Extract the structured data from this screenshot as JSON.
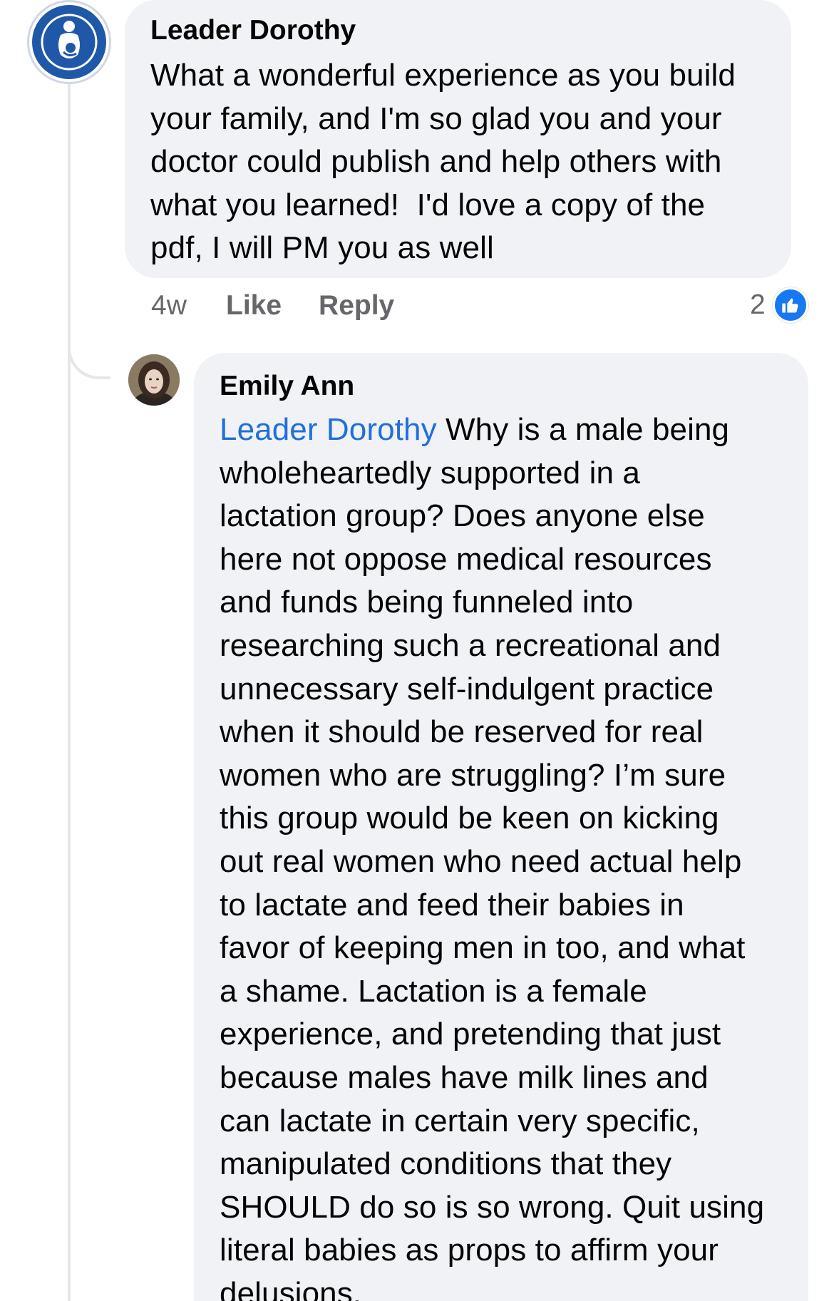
{
  "comments": [
    {
      "author": "Leader Dorothy",
      "lines": [
        "What a wonderful experience as you build",
        "your family, and I'm so glad you and your",
        "doctor could publish and help others with",
        "what you learned!  I'd love a copy of the",
        "pdf, I will PM you as well"
      ],
      "time": "4w",
      "like_label": "Like",
      "reply_label": "Reply",
      "reaction_count": "2",
      "reaction_icon": "thumbs-up-icon",
      "reaction_color": "#1877f2"
    },
    {
      "author": "Emily Ann",
      "mention": "Leader Dorothy",
      "first_line_rest": " Why is a male being",
      "lines": [
        "wholeheartedly supported in a",
        "lactation group? Does anyone else",
        "here not oppose medical resources",
        "and funds being funneled into",
        "researching such a recreational and",
        "unnecessary self-indulgent practice",
        "when it should be reserved for real",
        "women who are struggling? I’m sure",
        "this group would be keen on kicking",
        "out real women who need actual help",
        "to lactate and feed their babies in",
        "favor of keeping men in too, and what",
        "a shame. Lactation is a female",
        "experience, and pretending that just",
        "because males have milk lines and",
        "can lactate in certain very specific,",
        "manipulated conditions that they",
        "SHOULD do so is so wrong. Quit using",
        "literal babies as props to affirm your",
        "delusions."
      ],
      "mention_color": "#216fdb"
    }
  ]
}
